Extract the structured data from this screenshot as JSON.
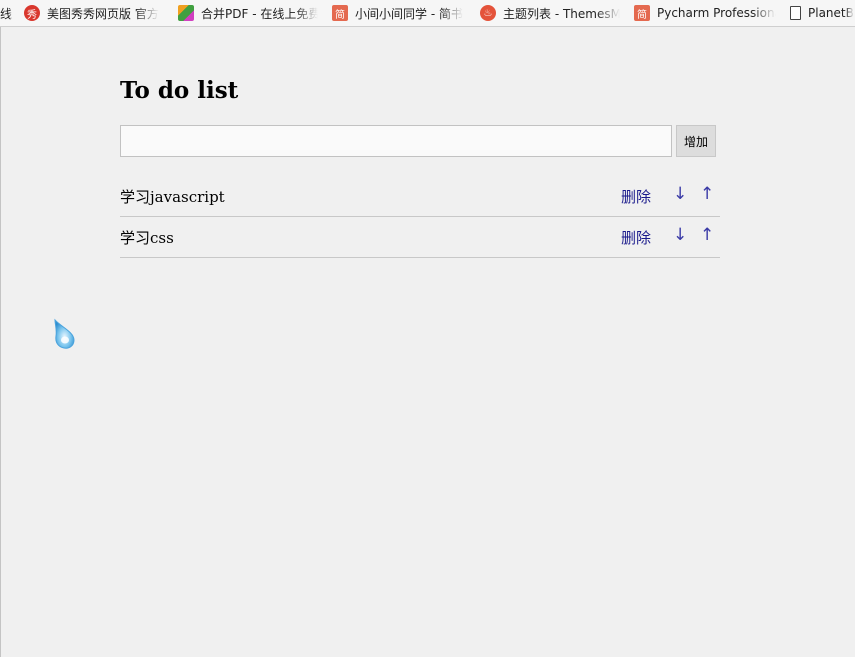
{
  "bookmarks": [
    {
      "label": "线",
      "icon": "none"
    },
    {
      "label": "美图秀秀网页版 官方",
      "icon": "meitu-icon"
    },
    {
      "label": "合并PDF - 在线上免费",
      "icon": "pdf-merge-icon"
    },
    {
      "label": "小间小间同学 - 简书",
      "icon": "jianshu-icon"
    },
    {
      "label": "主题列表 - ThemesM",
      "icon": "flame-icon"
    },
    {
      "label": "Pycharm Professional",
      "icon": "jianshu-icon"
    },
    {
      "label": "PlanetB",
      "icon": "page-icon"
    }
  ],
  "app": {
    "title": "To do list",
    "input": {
      "value": "",
      "placeholder": ""
    },
    "add_label": "增加",
    "todos": [
      {
        "text": "学习javascript",
        "delete_label": "删除",
        "down_arrow": "↓",
        "up_arrow": "↑"
      },
      {
        "text": "学习css",
        "delete_label": "删除",
        "down_arrow": "↓",
        "up_arrow": "↑"
      }
    ]
  },
  "colors": {
    "page_background": "#f0f0f0",
    "link": "#1a1a8c",
    "arrow": "#3a3aa6"
  }
}
